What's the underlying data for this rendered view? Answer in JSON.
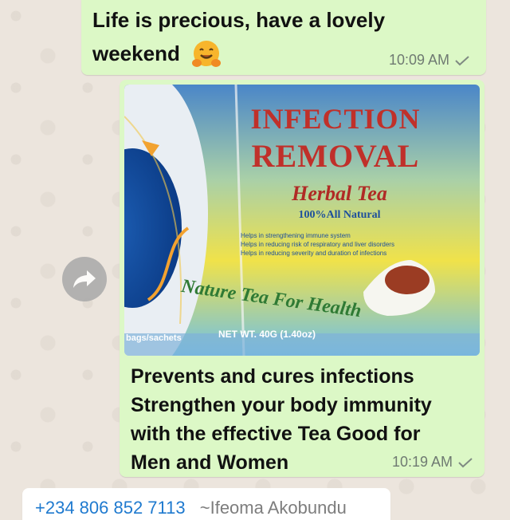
{
  "messages": [
    {
      "text_line1": "Life is precious,  have a lovely",
      "text_line2": "weekend",
      "emoji": "hugging-face",
      "time": "10:09 AM"
    },
    {
      "image": {
        "title1": "INFECTION",
        "title2": "REMOVAL",
        "subtitle": "Herbal Tea",
        "natural": "100%All Natural",
        "bullets": [
          "Helps in strengthening immune system",
          "Helps in reducing risk of respiratory and liver disorders",
          "Helps in reducing severity and duration of infections"
        ],
        "slogan": "Nature Tea For Health",
        "left_label": "bags/sachets",
        "weight": "NET WT. 40G (1.40oz)"
      },
      "caption_lines": [
        "Prevents and cures infections",
        "Strengthen your body immunity",
        "with the effective  Tea Good for",
        "Men and Women"
      ],
      "time": "10:19 AM"
    }
  ],
  "next_message": {
    "phone": "+234 806 852 7113",
    "sender": "~Ifeoma Akobundu"
  },
  "colors": {
    "outgoing_bubble": "#dcf8c6",
    "chat_background": "#ece5dd",
    "phone_link": "#1f7acf"
  }
}
